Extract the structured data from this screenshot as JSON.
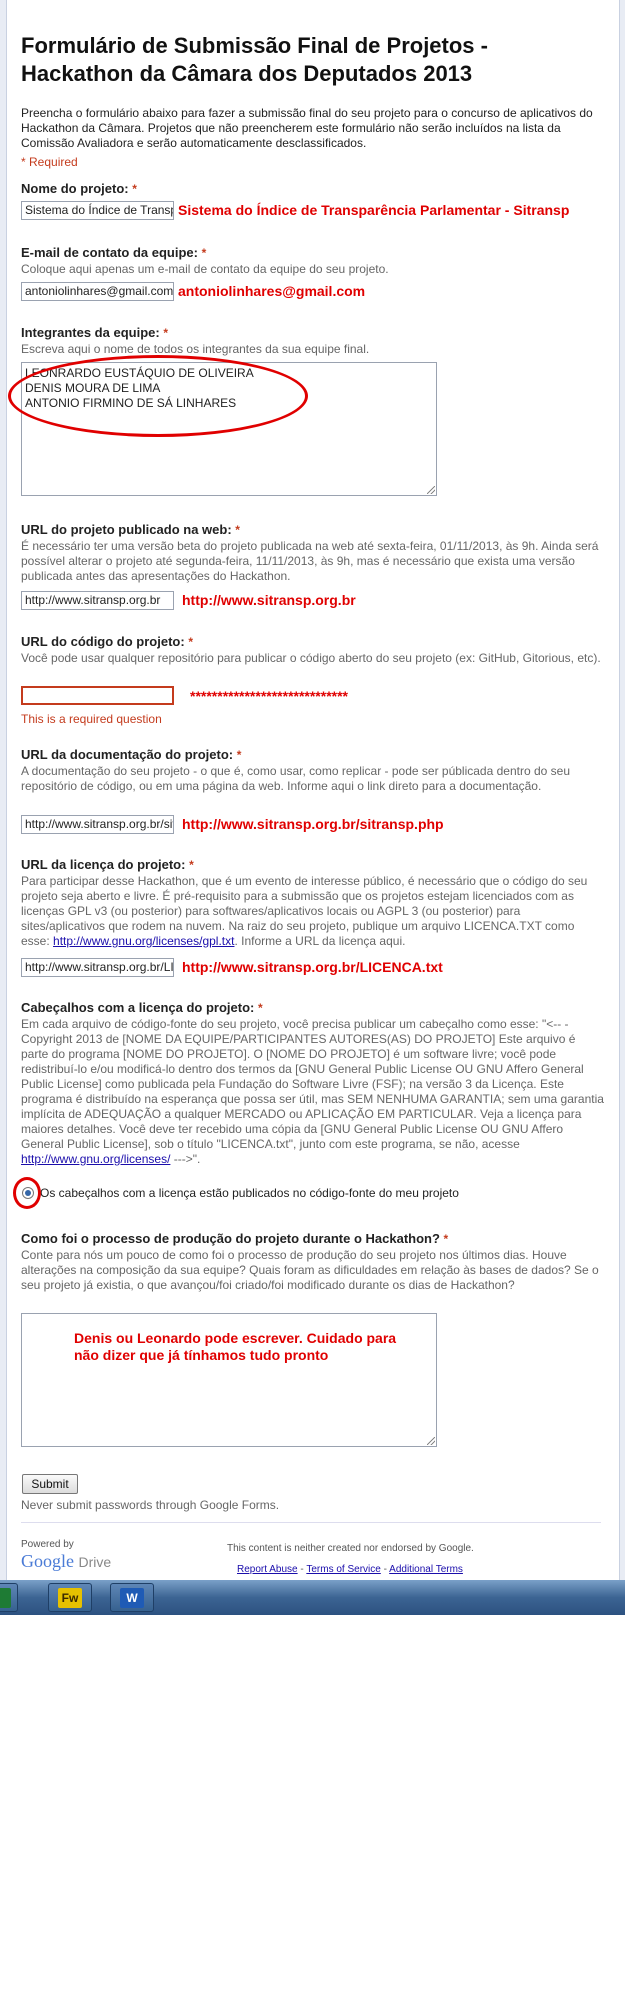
{
  "form": {
    "title": "Formulário de Submissão Final de Projetos - Hackathon da Câmara dos Deputados 2013",
    "description": "Preencha o formulário abaixo para fazer a submissão final do seu projeto para o concurso de aplicativos do Hackathon da Câmara. Projetos que não preencherem este formulário não serão incluídos na lista da Comissão Avaliadora e serão automaticamente desclassificados.",
    "required_note": "* Required",
    "req_star": "*"
  },
  "q_nome": {
    "title": "Nome do projeto:",
    "value": "Sistema do Índice de Transparência Parlamentar - Sitransp",
    "annotation": "Sistema do Índice de Transparência Parlamentar - Sitransp"
  },
  "q_email": {
    "title": "E-mail de contato da equipe:",
    "help": "Coloque aqui apenas um e-mail de contato da equipe do seu projeto.",
    "value": "antoniolinhares@gmail.com",
    "annotation": "antoniolinhares@gmail.com"
  },
  "q_integrantes": {
    "title": "Integrantes da equipe:",
    "help": "Escreva aqui o nome de todos os integrantes da sua equipe final.",
    "lines": [
      "LEONRARDO EUSTÁQUIO DE OLIVEIRA",
      "DENIS MOURA DE LIMA",
      "ANTONIO FIRMINO DE SÁ LINHARES"
    ]
  },
  "q_url_web": {
    "title": "URL do projeto publicado na web:",
    "help": "É necessário ter uma versão beta do projeto publicada na web até sexta-feira, 01/11/2013, às 9h. Ainda será possível alterar o projeto até segunda-feira, 11/11/2013, às 9h, mas é necessário que exista uma versão publicada antes das apresentações do Hackathon.",
    "value": "http://www.sitransp.org.br",
    "annotation": "http://www.sitransp.org.br"
  },
  "q_url_codigo": {
    "title": "URL do código do projeto:",
    "help": "Você pode usar qualquer repositório para publicar o código aberto do seu projeto (ex: GitHub, Gitorious, etc).",
    "value": "",
    "error": "This is a required question",
    "annotation": "*****************************"
  },
  "q_url_doc": {
    "title": "URL da documentação do projeto:",
    "help": "A documentação do seu projeto - o que é, como usar, como replicar - pode ser públicada dentro do seu repositório de código, ou em uma página da web. Informe aqui o link direto para a documentação.",
    "value": "http://www.sitransp.org.br/sitransp.php",
    "annotation": "http://www.sitransp.org.br/sitransp.php"
  },
  "q_url_licenca": {
    "title": "URL da licença do projeto:",
    "help_a": "Para participar desse Hackathon, que é um evento de interesse público, é necessário que o código do seu projeto seja aberto e livre. É pré-requisito para a submissão que os projetos estejam licenciados com as licenças GPL v3 (ou posterior) para softwares/aplicativos locais ou AGPL 3 (ou posterior) para sites/aplicativos que rodem na nuvem. Na raiz do seu projeto, publique um arquivo LICENCA.TXT como esse:",
    "help_link": "http://www.gnu.org/licenses/gpl.txt",
    "help_b": ". Informe a URL da licença aqui.",
    "value": "http://www.sitransp.org.br/LICENCA.txt",
    "annotation": "http://www.sitransp.org.br/LICENCA.txt"
  },
  "q_cabecalhos": {
    "title": "Cabeçalhos com a licença do projeto:",
    "help_a": "Em cada arquivo de código-fonte do seu projeto, você precisa publicar um cabeçalho como esse: \"<-- - Copyright 2013 de [NOME DA EQUIPE/PARTICIPANTES AUTORES(AS) DO PROJETO] Este arquivo é parte do programa [NOME DO PROJETO]. O [NOME DO PROJETO] é um software livre; você pode redistribuí-lo e/ou modificá-lo dentro dos termos da [GNU General Public License OU GNU Affero General Public License] como publicada pela Fundação do Software Livre (FSF); na versão 3 da Licença. Este programa é distribuído na esperança que possa ser útil, mas SEM NENHUMA GARANTIA; sem uma garantia implícita de ADEQUAÇÃO a qualquer MERCADO ou APLICAÇÃO EM PARTICULAR. Veja a licença para maiores detalhes. Você deve ter recebido uma cópia da [GNU General Public License OU GNU Affero General Public License], sob o título \"LICENCA.txt\", junto com este programa, se não, acesse",
    "help_link": "http://www.gnu.org/licenses/",
    "help_b": " --->\".",
    "option": "Os cabeçalhos com a licença estão publicados no código-fonte do meu projeto"
  },
  "q_processo": {
    "title": "Como foi o processo de produção do projeto durante o Hackathon?",
    "help": "Conte para nós um pouco de como foi o processo de produção do seu projeto nos últimos dias. Houve alterações na composição da sua equipe? Quais foram as dificuldades em relação às bases de dados? Se o seu projeto já existia, o que avançou/foi criado/foi modificado durante os dias de Hackathon?",
    "annotation": "Denis ou Leonardo pode escrever. Cuidado para não dizer que já tínhamos tudo pronto"
  },
  "submit": {
    "label": "Submit",
    "note": "Never submit passwords through Google Forms."
  },
  "footer": {
    "powered_by": "Powered by",
    "google": "Google",
    "drive": "Drive",
    "disclaimer": "This content is neither created nor endorsed by Google.",
    "report_abuse": "Report Abuse",
    "sep": "-",
    "terms": "Terms of Service",
    "additional": "Additional Terms"
  },
  "taskbar": {
    "fw_label": "Fw",
    "word_label": "W",
    "colors": {
      "fw": "#e6c100",
      "word": "#1f5bb5",
      "excel": "#1e7b34"
    }
  },
  "colors": {
    "annotation": "#e00000",
    "required": "#c43b1d",
    "link": "#1a0dab"
  }
}
